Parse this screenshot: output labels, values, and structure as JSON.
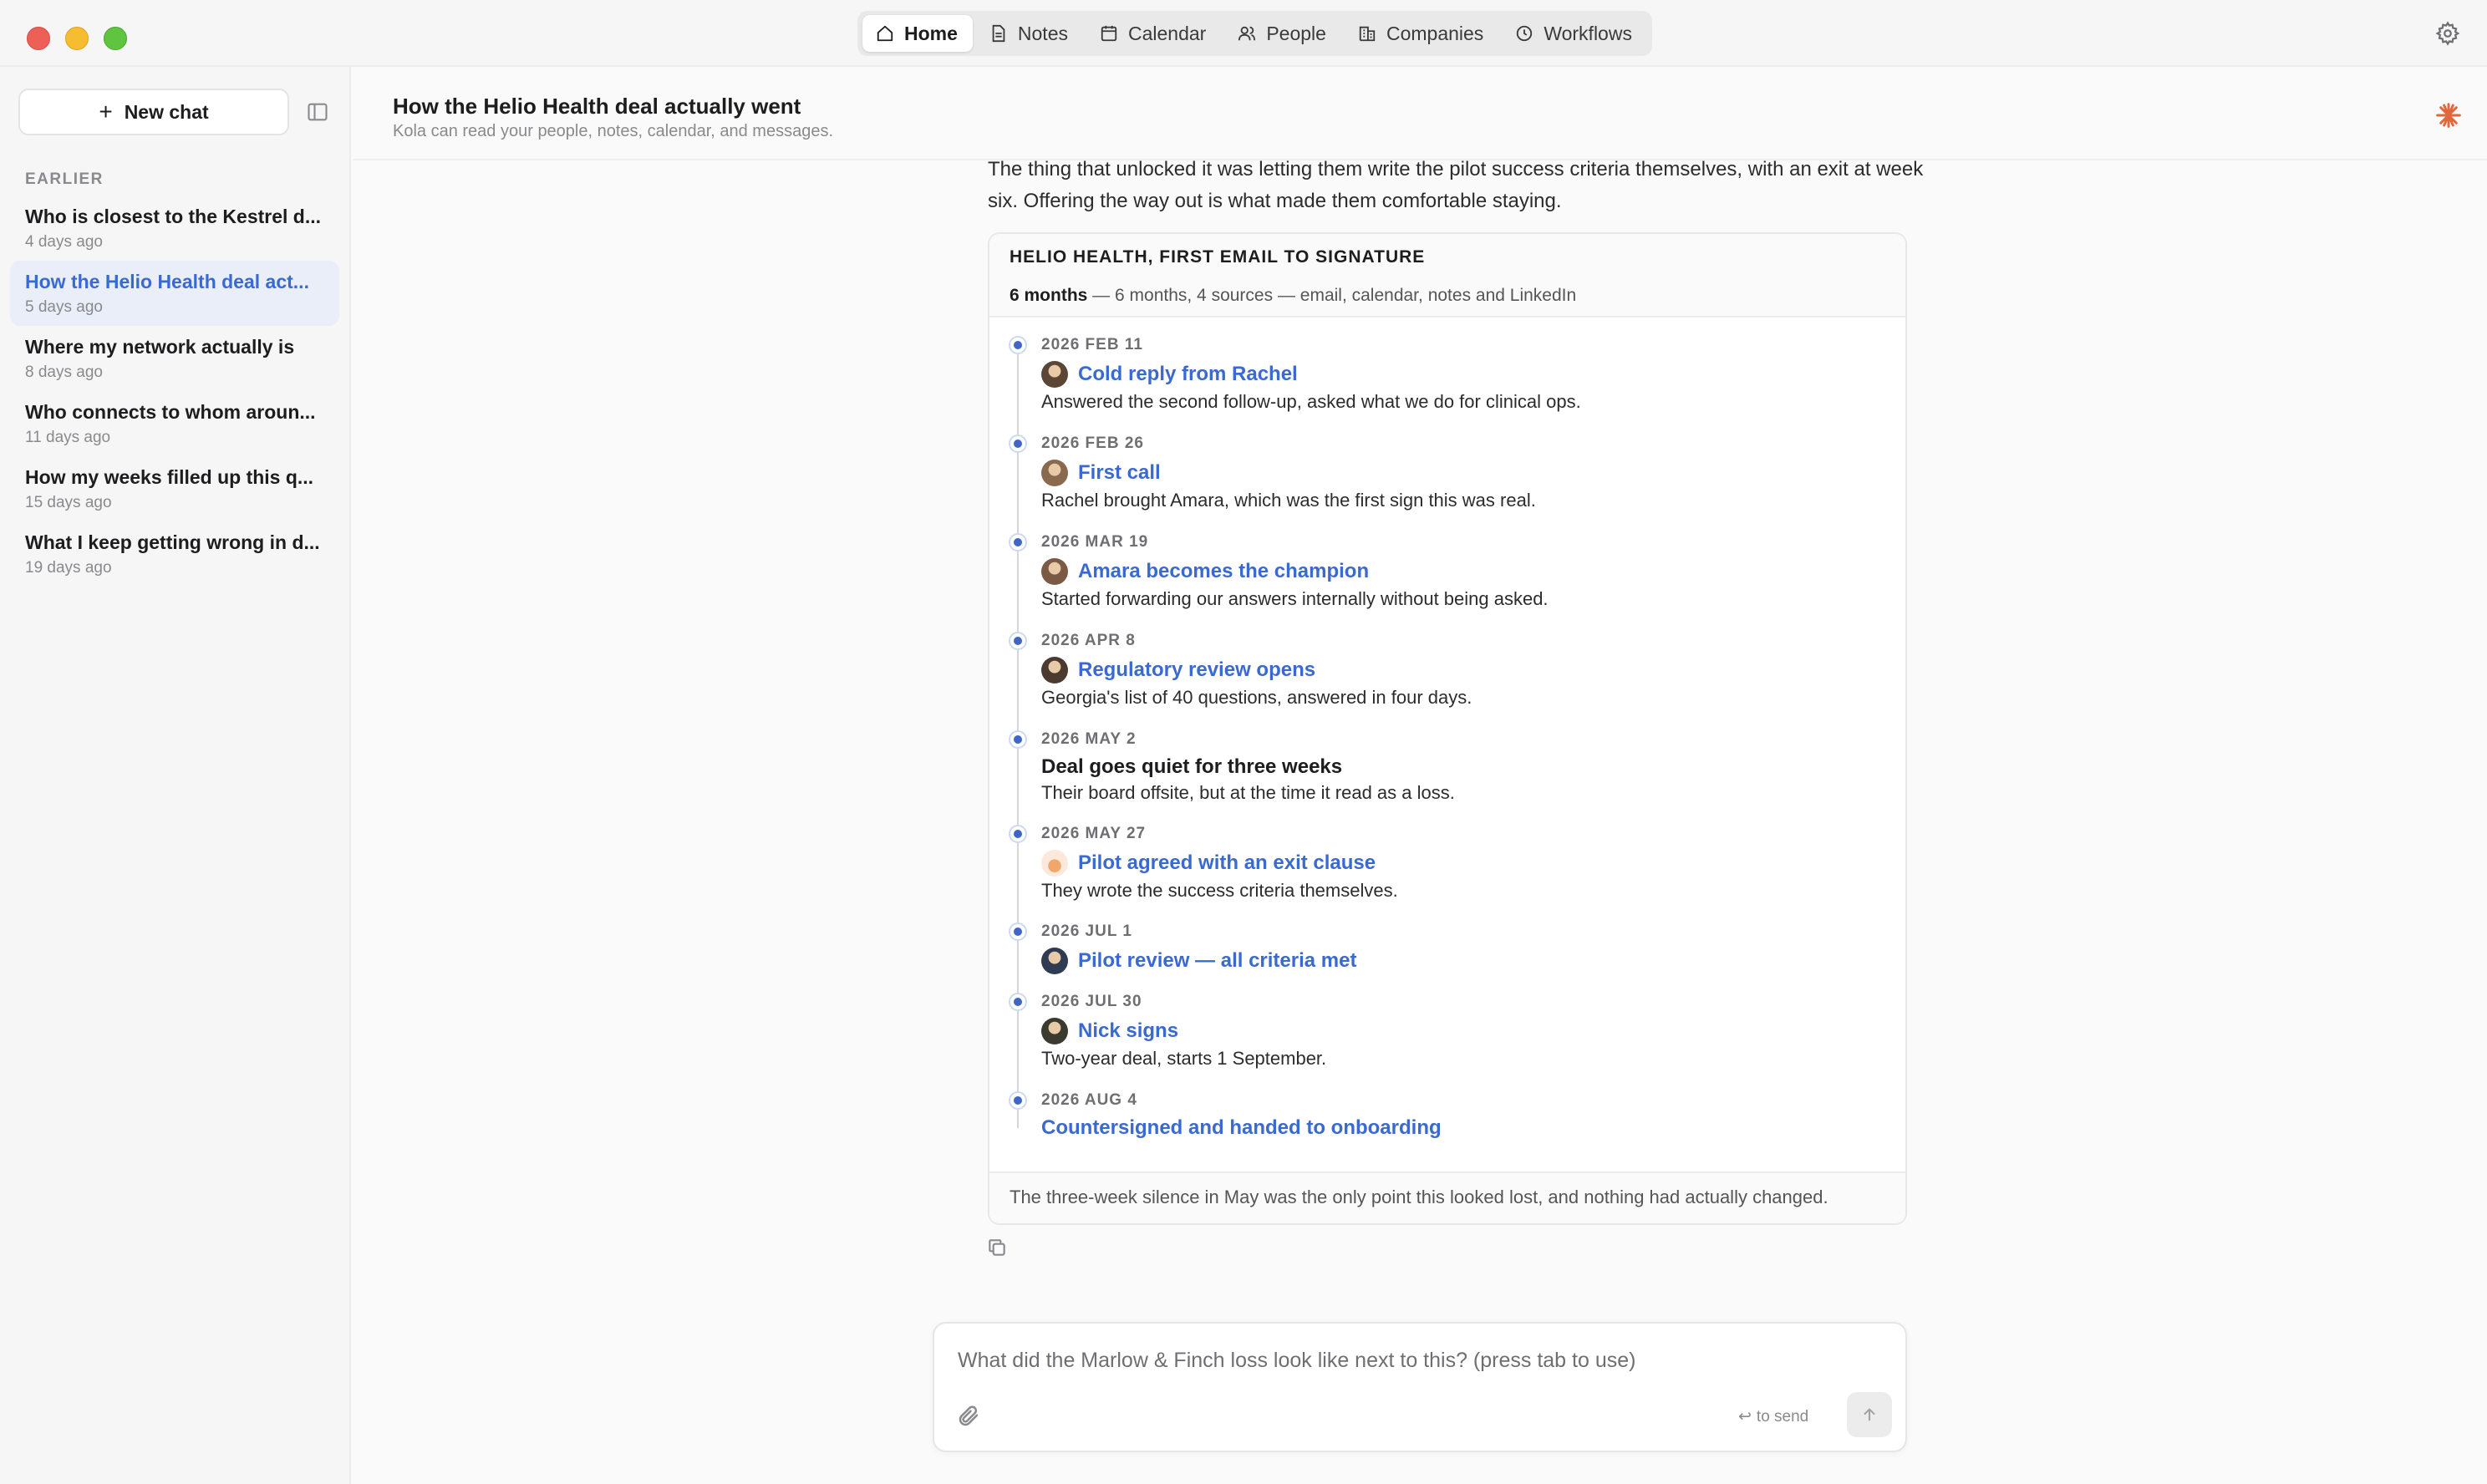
{
  "nav": {
    "tabs": [
      {
        "label": "Home",
        "icon": "home-icon"
      },
      {
        "label": "Notes",
        "icon": "note-icon"
      },
      {
        "label": "Calendar",
        "icon": "calendar-icon"
      },
      {
        "label": "People",
        "icon": "people-icon"
      },
      {
        "label": "Companies",
        "icon": "building-icon"
      },
      {
        "label": "Workflows",
        "icon": "clock-icon"
      }
    ],
    "active": "Home"
  },
  "sidebar": {
    "new_chat_label": "New chat",
    "section_label": "EARLIER",
    "items": [
      {
        "title": "Who is closest to the Kestrel d...",
        "time": "4 days ago"
      },
      {
        "title": "How the Helio Health deal act...",
        "time": "5 days ago"
      },
      {
        "title": "Where my network actually is",
        "time": "8 days ago"
      },
      {
        "title": "Who connects to whom aroun...",
        "time": "11 days ago"
      },
      {
        "title": "How my weeks filled up this q...",
        "time": "15 days ago"
      },
      {
        "title": "What I keep getting wrong in d...",
        "time": "19 days ago"
      }
    ]
  },
  "header": {
    "title": "How the Helio Health deal actually went",
    "subtitle": "Kola can read your people, notes, calendar, and messages."
  },
  "message": {
    "intro": "The thing that unlocked it was letting them write the pilot success criteria themselves, with an exit at week six. Offering the way out is what made them comfortable staying."
  },
  "card": {
    "title": "HELIO HEALTH, FIRST EMAIL TO SIGNATURE",
    "meta_bold": "6 months",
    "meta_rest": " — 6 months, 4 sources — email, calendar, notes and LinkedIn",
    "events": [
      {
        "date": "2026 FEB 11",
        "title": "Cold reply from Rachel",
        "desc": "Answered the second follow-up, asked what we do for clinical ops.",
        "link": true,
        "avatar": "photo"
      },
      {
        "date": "2026 FEB 26",
        "title": "First call",
        "desc": "Rachel brought Amara, which was the first sign this was real.",
        "link": true,
        "avatar": "photo"
      },
      {
        "date": "2026 MAR 19",
        "title": "Amara becomes the champion",
        "desc": "Started forwarding our answers internally without being asked.",
        "link": true,
        "avatar": "photo"
      },
      {
        "date": "2026 APR 8",
        "title": "Regulatory review opens",
        "desc": "Georgia's list of 40 questions, answered in four days.",
        "link": true,
        "avatar": "photo"
      },
      {
        "date": "2026 MAY 2",
        "title": "Deal goes quiet for three weeks",
        "desc": "Their board offsite, but at the time it read as a loss.",
        "link": false,
        "avatar": "none"
      },
      {
        "date": "2026 MAY 27",
        "title": "Pilot agreed with an exit clause",
        "desc": "They wrote the success criteria themselves.",
        "link": true,
        "avatar": "logo"
      },
      {
        "date": "2026 JUL 1",
        "title": "Pilot review — all criteria met",
        "desc": "",
        "link": true,
        "avatar": "photo"
      },
      {
        "date": "2026 JUL 30",
        "title": "Nick signs",
        "desc": "Two-year deal, starts 1 September.",
        "link": true,
        "avatar": "photo"
      },
      {
        "date": "2026 AUG 4",
        "title": "Countersigned and handed to onboarding",
        "desc": "",
        "link": true,
        "avatar": "none"
      }
    ],
    "footer": "The three-week silence in May was the only point this looked lost, and nothing had actually changed."
  },
  "composer": {
    "placeholder": "What did the Marlow & Finch loss look like next to this? (press tab to use)",
    "send_hint": "to send"
  },
  "colors": {
    "accent": "#3a6ad0",
    "active_bg": "#e9eef9",
    "dot": "#3f66c4",
    "spark": "#e0683c"
  }
}
